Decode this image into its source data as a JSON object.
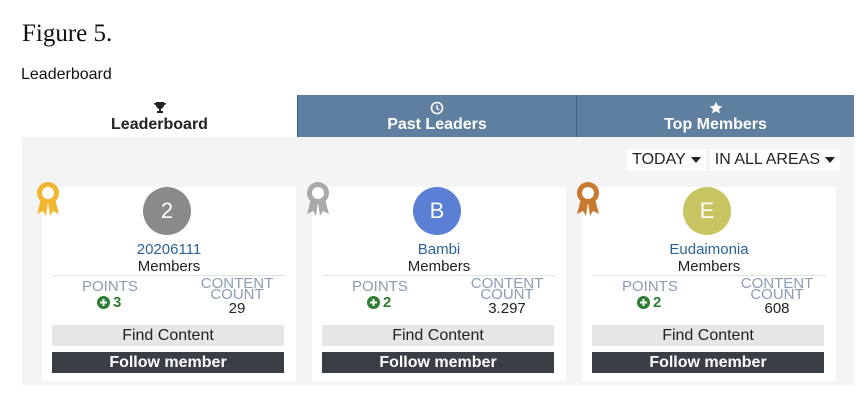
{
  "figure_caption": "Figure 5.",
  "page_heading": "Leaderboard",
  "tabs": [
    {
      "label": "Leaderboard",
      "icon": "trophy-icon",
      "active": true
    },
    {
      "label": "Past Leaders",
      "icon": "clock-icon",
      "active": false
    },
    {
      "label": "Top Members",
      "icon": "star-icon",
      "active": false
    }
  ],
  "filters": {
    "period": "TODAY",
    "area": "IN ALL AREAS"
  },
  "labels": {
    "points": "POINTS",
    "content": "CONTENT",
    "count": "COUNT",
    "find_content": "Find Content",
    "follow_member": "Follow member"
  },
  "members": [
    {
      "avatar_letter": "2",
      "avatar_color": "#8a8a8a",
      "name": "20206111",
      "group": "Members",
      "points": "3",
      "content_count": "29",
      "medal": "gold",
      "medal_color": "#f2b632"
    },
    {
      "avatar_letter": "B",
      "avatar_color": "#5b7fd4",
      "name": "Bambi",
      "group": "Members",
      "points": "2",
      "content_count": "3.297",
      "medal": "silver",
      "medal_color": "#a9a9a9"
    },
    {
      "avatar_letter": "E",
      "avatar_color": "#c9c462",
      "name": "Eudaimonia",
      "group": "Members",
      "points": "2",
      "content_count": "608",
      "medal": "bronze",
      "medal_color": "#c8782f"
    }
  ],
  "colors": {
    "tab_inactive": "#5f7fa1",
    "link": "#2b6396",
    "points_green": "#2e7d32",
    "follow_button": "#3a3f45"
  }
}
